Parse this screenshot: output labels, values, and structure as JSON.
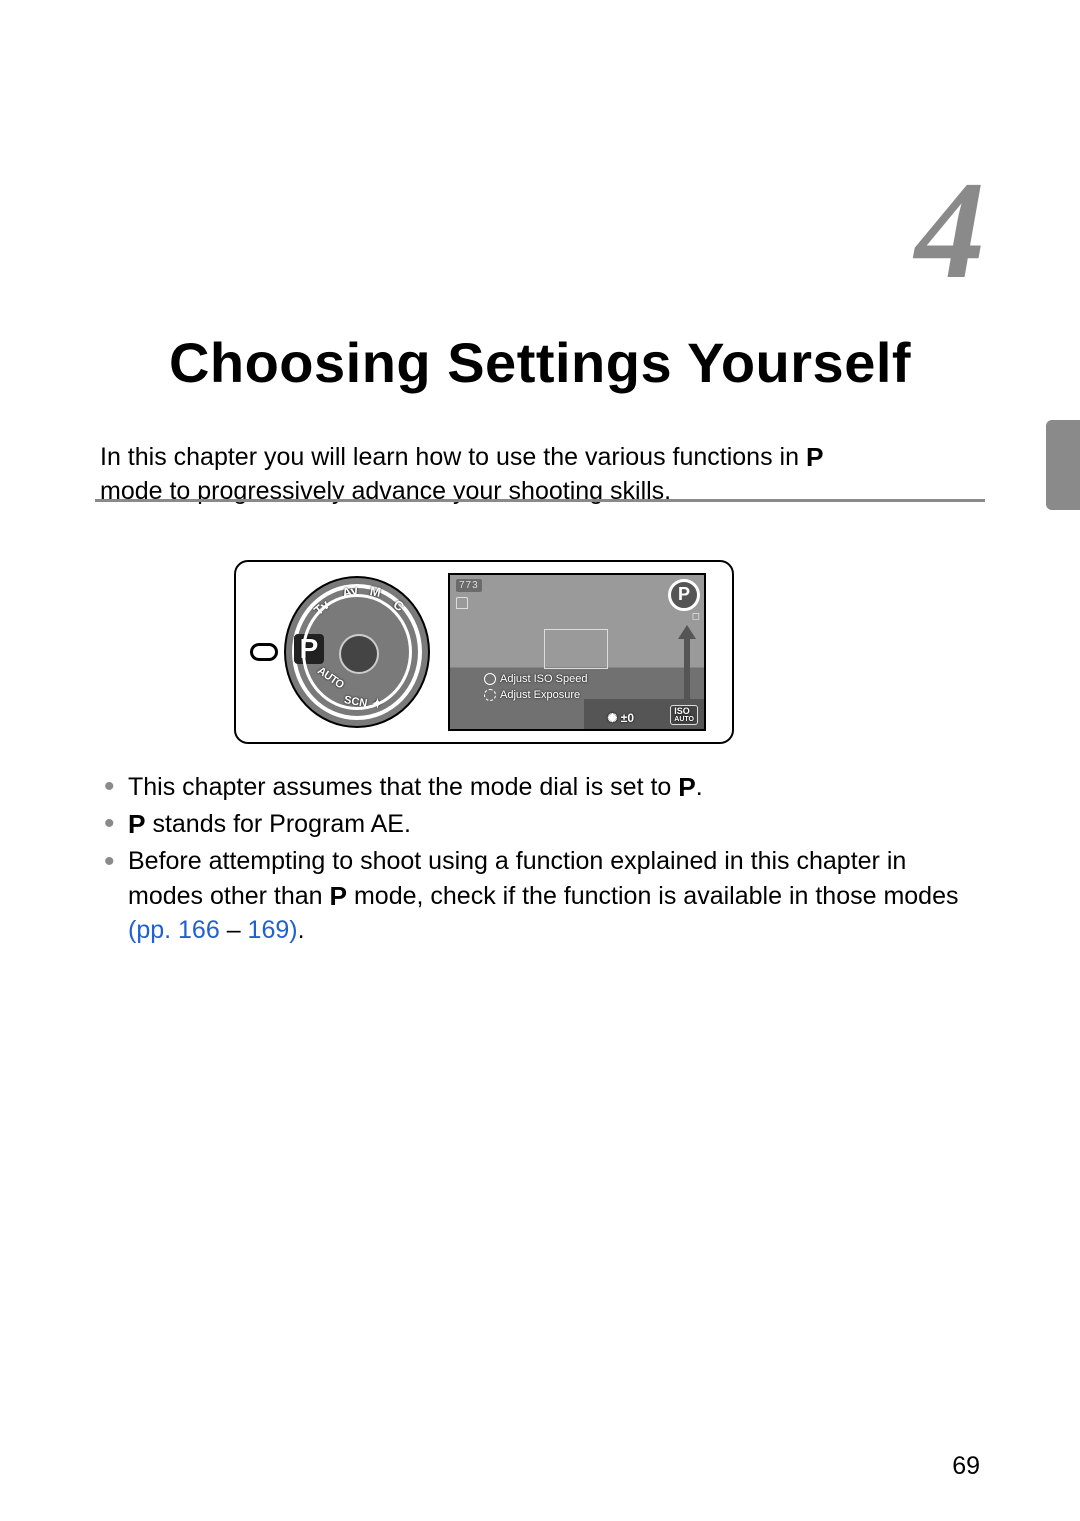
{
  "chapter_number": "4",
  "chapter_title": "Choosing Settings Yourself",
  "intro": {
    "line1_pre": "In this chapter you will learn how to use the various functions in ",
    "p_symbol": "P",
    "line2": "mode to progressively advance your shooting skills."
  },
  "illustration": {
    "dial": {
      "selected": "P",
      "tv": "Tv",
      "av": "Av",
      "m": "M",
      "c": "C",
      "auto": "AUTO",
      "scn": "SCN",
      "star": "✦"
    },
    "lcd": {
      "top_info": "773",
      "p_badge": "P",
      "hint1": "Adjust ISO Speed",
      "hint2": "Adjust Exposure",
      "ev": "±0",
      "iso_top": "ISO",
      "iso_bottom": "AUTO"
    }
  },
  "bullets": {
    "b1_pre": "This chapter assumes that the mode dial is set to ",
    "b1_post": ".",
    "b2_pre": "",
    "b2_post": " stands for Program AE.",
    "b3_pre": "Before attempting to shoot using a function explained in this chapter in modes other than ",
    "b3_mid": " mode, check if the function is available in those modes ",
    "link1": "(pp. 166",
    "dash": " – ",
    "link2": "169)",
    "b3_post": "."
  },
  "p_symbol": "P",
  "page_number": "69"
}
